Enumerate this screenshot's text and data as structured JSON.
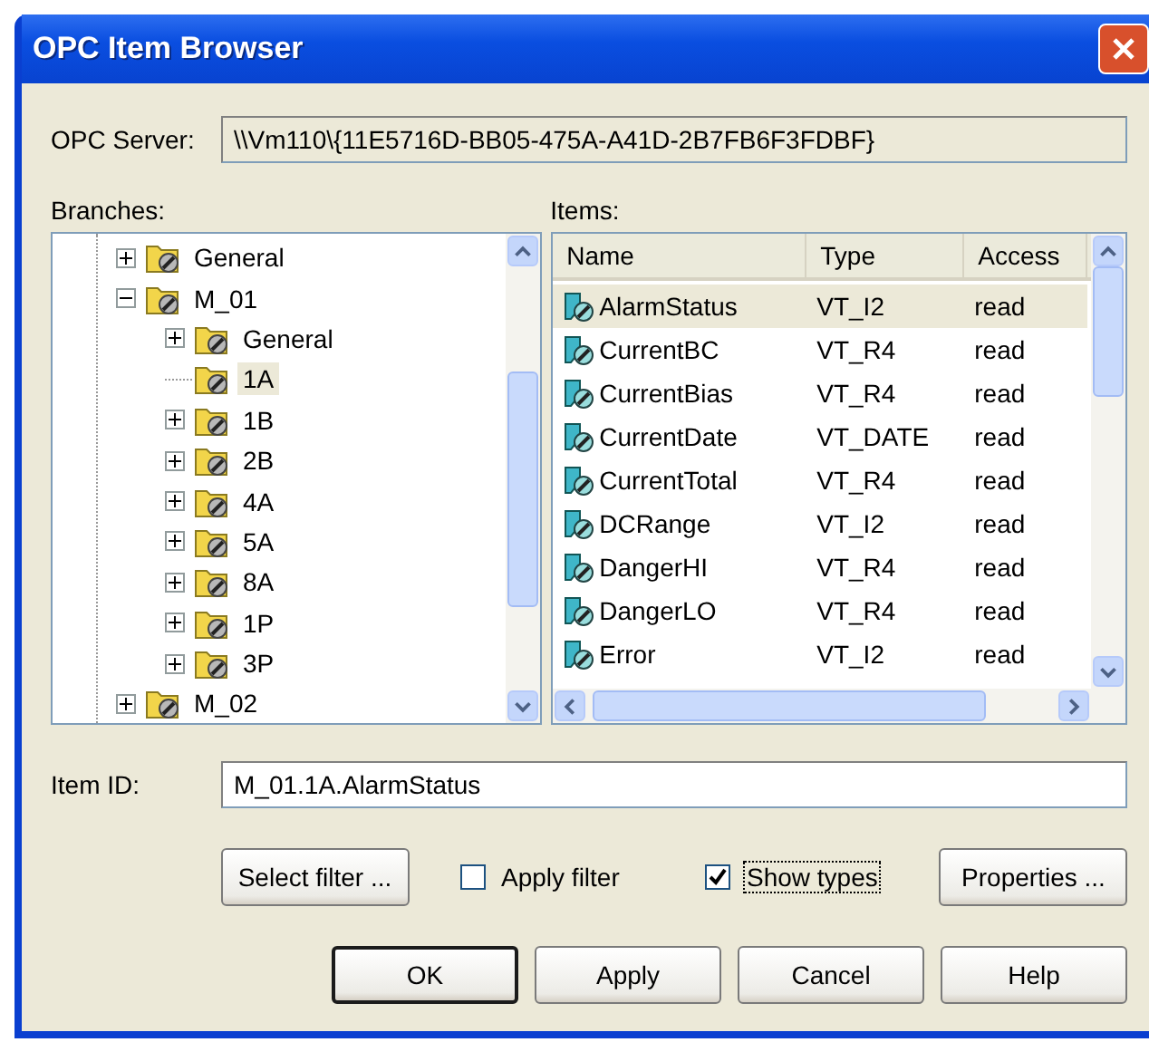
{
  "window": {
    "title": "OPC Item Browser"
  },
  "server": {
    "label": "OPC Server:",
    "value": "\\\\Vm110\\{11E5716D-BB05-475A-A41D-2B7FB6F3FDBF}"
  },
  "branches": {
    "label": "Branches:",
    "tree": [
      {
        "label": "General",
        "kind": "branch",
        "expanded": false,
        "selected": false
      },
      {
        "label": "M_01",
        "kind": "branch",
        "expanded": true,
        "selected": false,
        "children": [
          {
            "label": "General",
            "kind": "branch",
            "expanded": false,
            "selected": false
          },
          {
            "label": "1A",
            "kind": "leaf",
            "selected": true
          },
          {
            "label": "1B",
            "kind": "branch",
            "expanded": false,
            "selected": false
          },
          {
            "label": "2B",
            "kind": "branch",
            "expanded": false,
            "selected": false
          },
          {
            "label": "4A",
            "kind": "branch",
            "expanded": false,
            "selected": false
          },
          {
            "label": "5A",
            "kind": "branch",
            "expanded": false,
            "selected": false
          },
          {
            "label": "8A",
            "kind": "branch",
            "expanded": false,
            "selected": false
          },
          {
            "label": "1P",
            "kind": "branch",
            "expanded": false,
            "selected": false
          },
          {
            "label": "3P",
            "kind": "branch",
            "expanded": false,
            "selected": false
          }
        ]
      },
      {
        "label": "M_02",
        "kind": "branch",
        "expanded": false,
        "selected": false
      }
    ]
  },
  "items": {
    "label": "Items:",
    "columns": [
      "Name",
      "Type",
      "Access"
    ],
    "rows": [
      {
        "name": "AlarmStatus",
        "type": "VT_I2",
        "access": "read",
        "selected": true
      },
      {
        "name": "CurrentBC",
        "type": "VT_R4",
        "access": "read",
        "selected": false
      },
      {
        "name": "CurrentBias",
        "type": "VT_R4",
        "access": "read",
        "selected": false
      },
      {
        "name": "CurrentDate",
        "type": "VT_DATE",
        "access": "read",
        "selected": false
      },
      {
        "name": "CurrentTotal",
        "type": "VT_R4",
        "access": "read",
        "selected": false
      },
      {
        "name": "DCRange",
        "type": "VT_I2",
        "access": "read",
        "selected": false
      },
      {
        "name": "DangerHI",
        "type": "VT_R4",
        "access": "read",
        "selected": false
      },
      {
        "name": "DangerLO",
        "type": "VT_R4",
        "access": "read",
        "selected": false
      },
      {
        "name": "Error",
        "type": "VT_I2",
        "access": "read",
        "selected": false
      }
    ]
  },
  "item_id": {
    "label": "Item ID:",
    "value": "M_01.1A.AlarmStatus"
  },
  "options": [
    {
      "kind": "button",
      "label": "Select filter ..."
    },
    {
      "kind": "checkbox",
      "label": "Apply filter",
      "checked": false,
      "focused": false
    },
    {
      "kind": "checkbox",
      "label": "Show types",
      "checked": true,
      "focused": true
    },
    {
      "kind": "button",
      "label": "Properties ..."
    }
  ],
  "buttons": [
    {
      "label": "OK",
      "default": true
    },
    {
      "label": "Apply",
      "default": false
    },
    {
      "label": "Cancel",
      "default": false
    },
    {
      "label": "Help",
      "default": false
    }
  ]
}
